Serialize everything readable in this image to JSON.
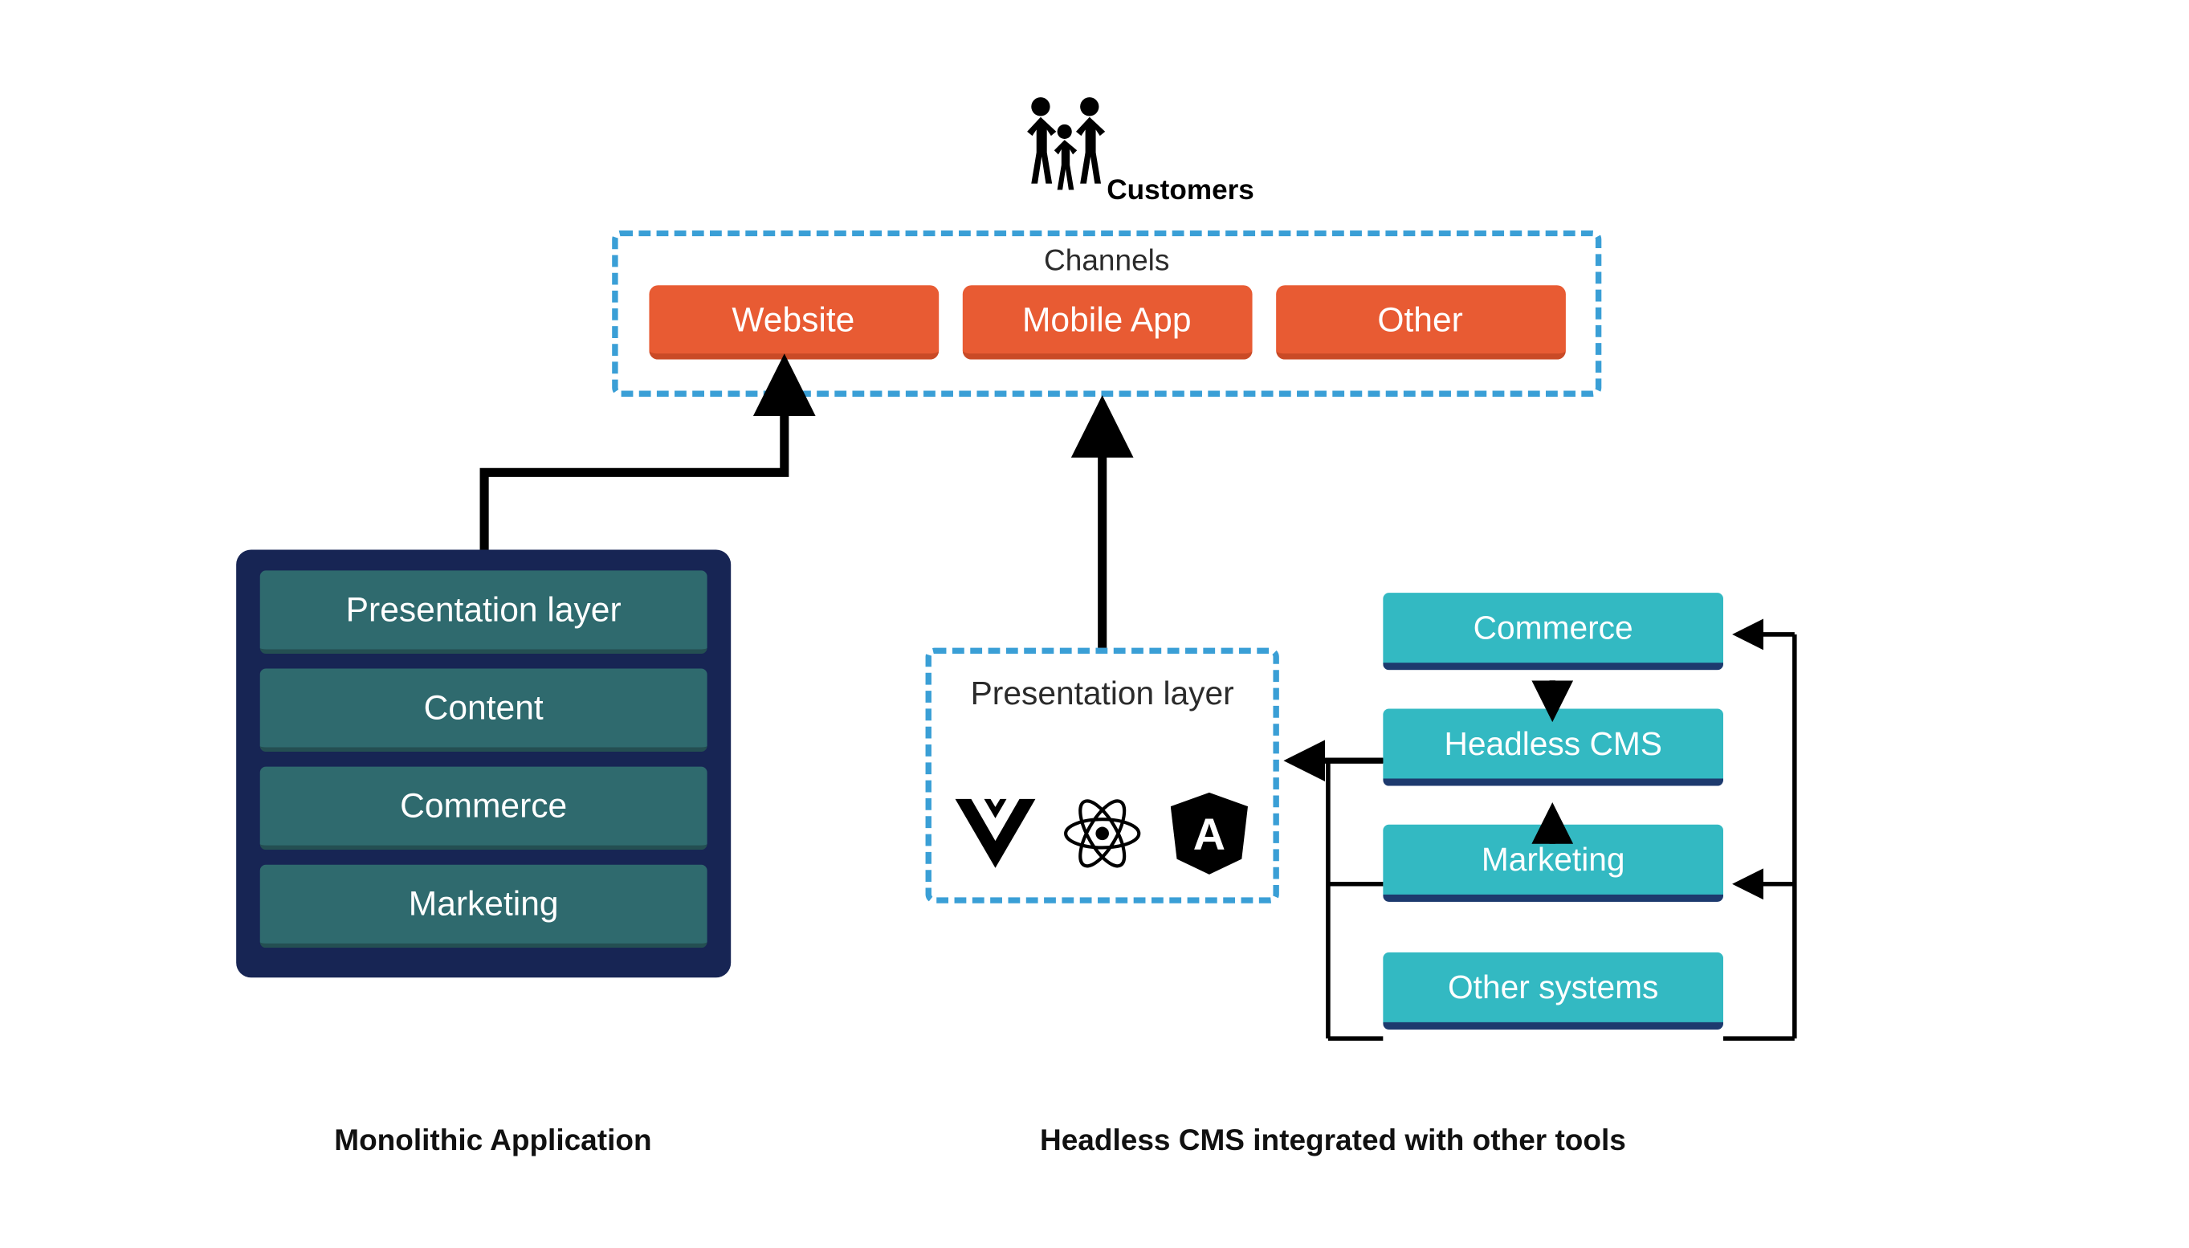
{
  "customers": {
    "label": "Customers"
  },
  "channels": {
    "title": "Channels",
    "items": [
      "Website",
      "Mobile App",
      "Other"
    ]
  },
  "monolithic": {
    "layers": [
      "Presentation layer",
      "Content",
      "Commerce",
      "Marketing"
    ],
    "caption": "Monolithic Application"
  },
  "presentation": {
    "title": "Presentation layer",
    "frameworks": [
      "vue-icon",
      "react-icon",
      "angular-icon"
    ]
  },
  "headless": {
    "stack": [
      "Commerce",
      "Headless CMS",
      "Marketing",
      "Other systems"
    ],
    "caption": "Headless CMS integrated with other tools"
  },
  "colors": {
    "dashedBorder": "#3a9fd6",
    "channelChip": "#e85b33",
    "monoBg": "#172554",
    "monoLayer": "#2f6a6e",
    "headlessBox": "#33b9c2",
    "arrow": "#000000"
  }
}
